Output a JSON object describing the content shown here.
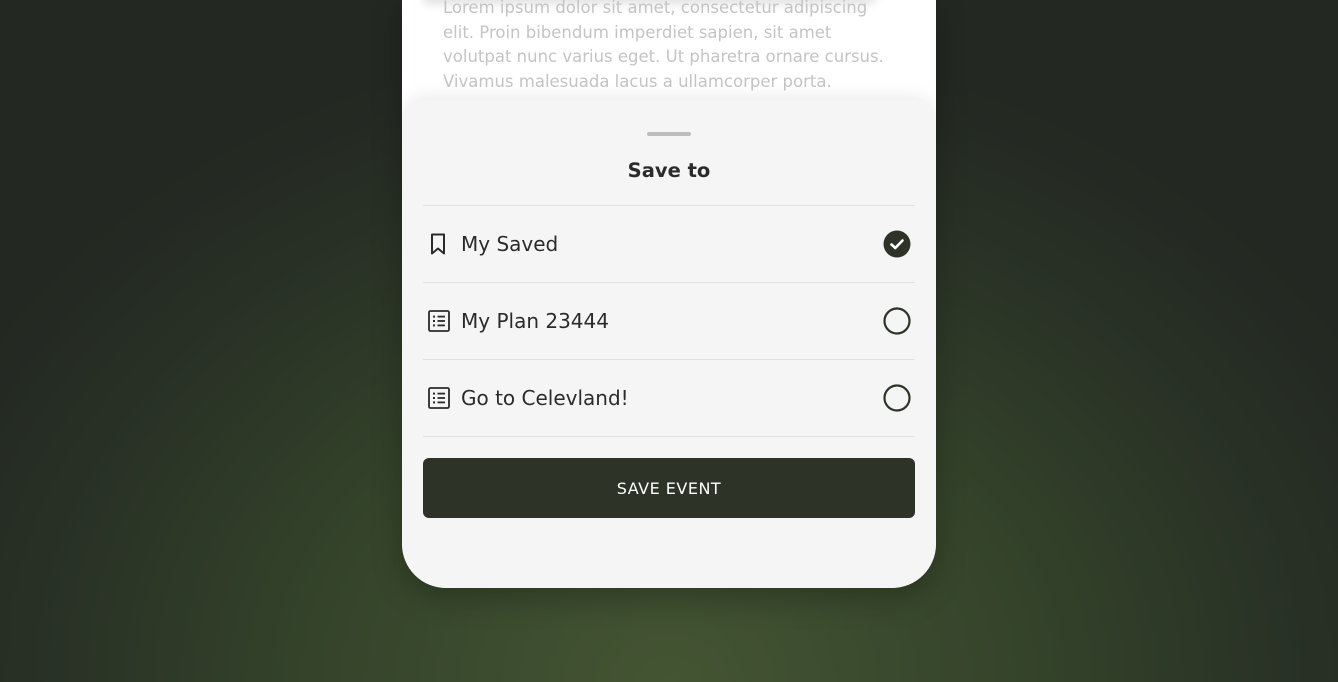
{
  "background_text": "Lorem ipsum dolor sit amet, consectetur adipiscing elit. Proin bibendum imperdiet sapien, sit amet volutpat nunc varius eget. Ut pharetra ornare cursus. Vivamus malesuada lacus a ullamcorper porta.",
  "sheet": {
    "title": "Save to",
    "items": [
      {
        "label": "My Saved",
        "icon": "bookmark-icon",
        "selected": true
      },
      {
        "label": "My Plan 23444",
        "icon": "list-icon",
        "selected": false
      },
      {
        "label": "Go to Celevland!",
        "icon": "list-icon",
        "selected": false
      }
    ],
    "save_label": "SAVE EVENT"
  },
  "colors": {
    "accent": "#2e3327",
    "sheet_bg": "#f5f5f5",
    "text": "#2b2b2b",
    "divider": "#e2e2e2",
    "background_green": "#445533"
  }
}
